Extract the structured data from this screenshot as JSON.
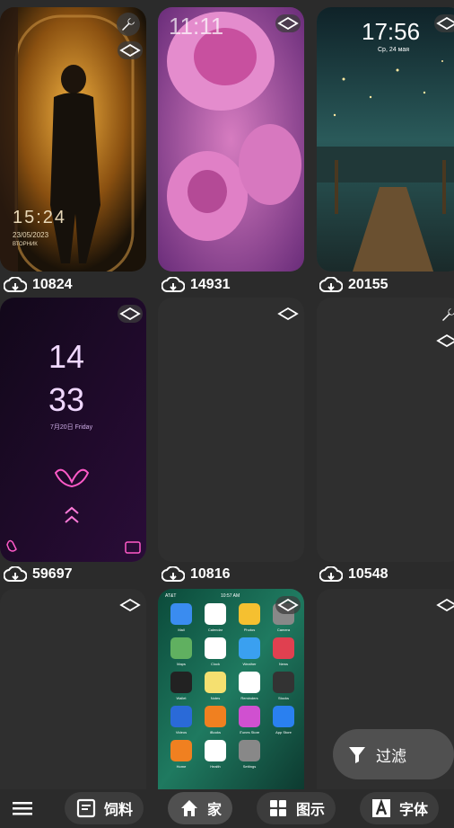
{
  "cards": [
    {
      "count": "10824",
      "clock": "15:24",
      "date": "23/05/2023",
      "day": "ВТОРНИК"
    },
    {
      "count": "14931",
      "clock": "11:11",
      "date": "",
      "day": ""
    },
    {
      "count": "20155",
      "clock": "17:56",
      "date": "Ср, 24 мая",
      "day": ""
    },
    {
      "count": "59697",
      "clock_h": "14",
      "clock_m": "33",
      "date": "7月20日 Friday"
    },
    {
      "count": "10816"
    },
    {
      "count": "10548"
    },
    {
      "count": ""
    },
    {
      "count": "",
      "apps": [
        "Mail",
        "Calendar",
        "Photos",
        "Camera",
        "Maps",
        "Clock",
        "Weather",
        "News",
        "Wallet",
        "Notes",
        "Reminders",
        "Stocks",
        "Videos",
        "iBooks",
        "iTunes Store",
        "App Store",
        "Home",
        "Health",
        "Settings"
      ],
      "status": "10:57 AM",
      "carrier": "AT&T"
    },
    {
      "count": ""
    }
  ],
  "nav": {
    "menu": "≡",
    "feed": "饲料",
    "home": "家",
    "icons": "图示",
    "fonts": "字体"
  },
  "fab": {
    "label": "过滤"
  },
  "colors": {
    "accent": "#ffffff",
    "background": "#2b2b2b",
    "card": "#3a3a3a"
  }
}
